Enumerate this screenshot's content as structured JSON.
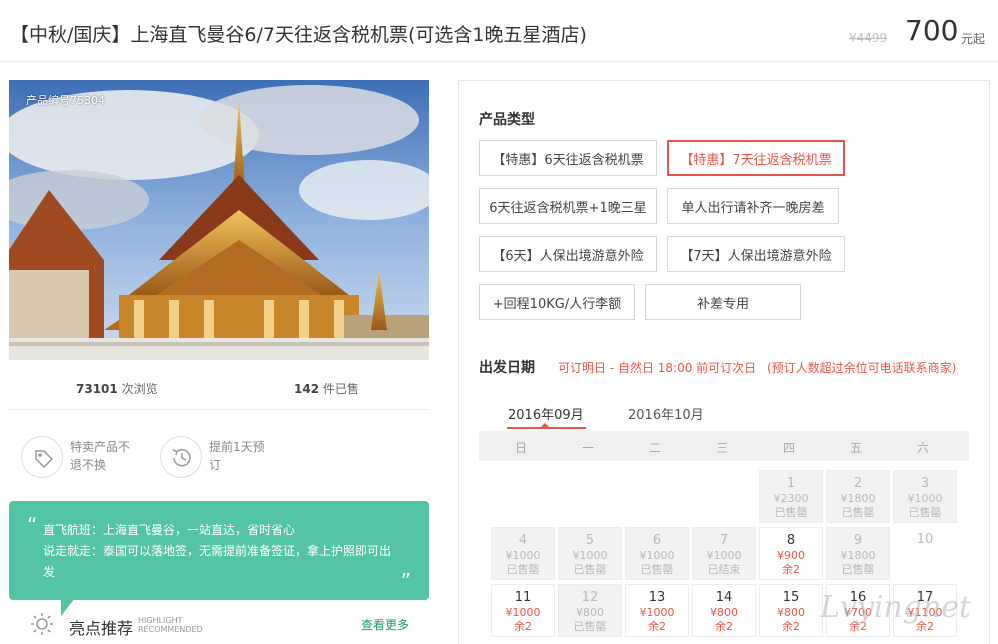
{
  "header": {
    "title": "【中秋/国庆】上海直飞曼谷6/7天往返含税机票(可选含1晚五星酒店)",
    "price_original": "¥4499",
    "price_current": "700",
    "price_unit": "元起"
  },
  "product": {
    "id_label": "产品编号75304",
    "views_count": "73101",
    "views_label": "次浏览",
    "sold_count": "142",
    "sold_label": "件已售"
  },
  "badges": [
    {
      "icon": "tag-icon",
      "line1": "特卖产品不",
      "line2": "退不换"
    },
    {
      "icon": "history-clock-icon",
      "line1": "提前1天预",
      "line2": "订"
    }
  ],
  "notice": {
    "line1": "直飞航班：上海直飞曼谷，一站直达，省时省心",
    "line2": "说走就走：泰国可以落地签，无需提前准备签证，拿上护照即可出",
    "line3": "发"
  },
  "highlight": {
    "title": "亮点推荐",
    "en1": "HIGHLIGHT",
    "en2": "RECOMMENDED",
    "more": "查看更多"
  },
  "product_type": {
    "label": "产品类型",
    "options": [
      {
        "label": "【特惠】6天往返含税机票",
        "selected": false
      },
      {
        "label": "【特惠】7天往返含税机票",
        "selected": true
      },
      {
        "label": "6天往返含税机票+1晚三星",
        "selected": false
      },
      {
        "label": "单人出行请补齐一晚房差",
        "selected": false
      },
      {
        "label": "【6天】人保出境游意外险",
        "selected": false
      },
      {
        "label": "【7天】人保出境游意外险",
        "selected": false
      },
      {
        "label": "+回程10KG/人行李额",
        "selected": false
      },
      {
        "label": "补差专用",
        "selected": false
      }
    ]
  },
  "departure": {
    "label": "出发日期",
    "hint1": "可订明日 - 自然日 18:00 前可订次日",
    "hint2": "(预订人数超过余位可电话联系商家)",
    "months": [
      "2016年09月",
      "2016年10月"
    ],
    "weekdays": [
      "日",
      "一",
      "二",
      "三",
      "四",
      "五",
      "六"
    ],
    "days": [
      {
        "day": "1",
        "price": "¥2300",
        "status": "已售罄",
        "state": "past"
      },
      {
        "day": "2",
        "price": "¥1800",
        "status": "已售罄",
        "state": "past"
      },
      {
        "day": "3",
        "price": "¥1000",
        "status": "已售罄",
        "state": "past"
      },
      {
        "day": "4",
        "price": "¥1000",
        "status": "已售罄",
        "state": "past"
      },
      {
        "day": "5",
        "price": "¥1000",
        "status": "已售罄",
        "state": "past"
      },
      {
        "day": "6",
        "price": "¥1000",
        "status": "已售罄",
        "state": "past"
      },
      {
        "day": "7",
        "price": "¥1000",
        "status": "已结束",
        "state": "past"
      },
      {
        "day": "8",
        "price": "¥900",
        "status": "余2",
        "state": "avail"
      },
      {
        "day": "9",
        "price": "¥1800",
        "status": "已售罄",
        "state": "past"
      },
      {
        "day": "10",
        "price": "",
        "status": "",
        "state": "empty"
      },
      {
        "day": "11",
        "price": "¥1000",
        "status": "余2",
        "state": "avail"
      },
      {
        "day": "12",
        "price": "¥800",
        "status": "已售罄",
        "state": "past"
      },
      {
        "day": "13",
        "price": "¥1000",
        "status": "余2",
        "state": "avail"
      },
      {
        "day": "14",
        "price": "¥800",
        "status": "余2",
        "state": "avail"
      },
      {
        "day": "15",
        "price": "¥800",
        "status": "余2",
        "state": "avail"
      },
      {
        "day": "16",
        "price": "¥700",
        "status": "余2",
        "state": "avail"
      },
      {
        "day": "17",
        "price": "¥1100",
        "status": "余2",
        "state": "avail"
      }
    ]
  },
  "watermark": "Lvyingnet",
  "colors": {
    "accent_red": "#e5574a",
    "notice_green": "#53c4a5",
    "link_green": "#1a9a6c"
  }
}
